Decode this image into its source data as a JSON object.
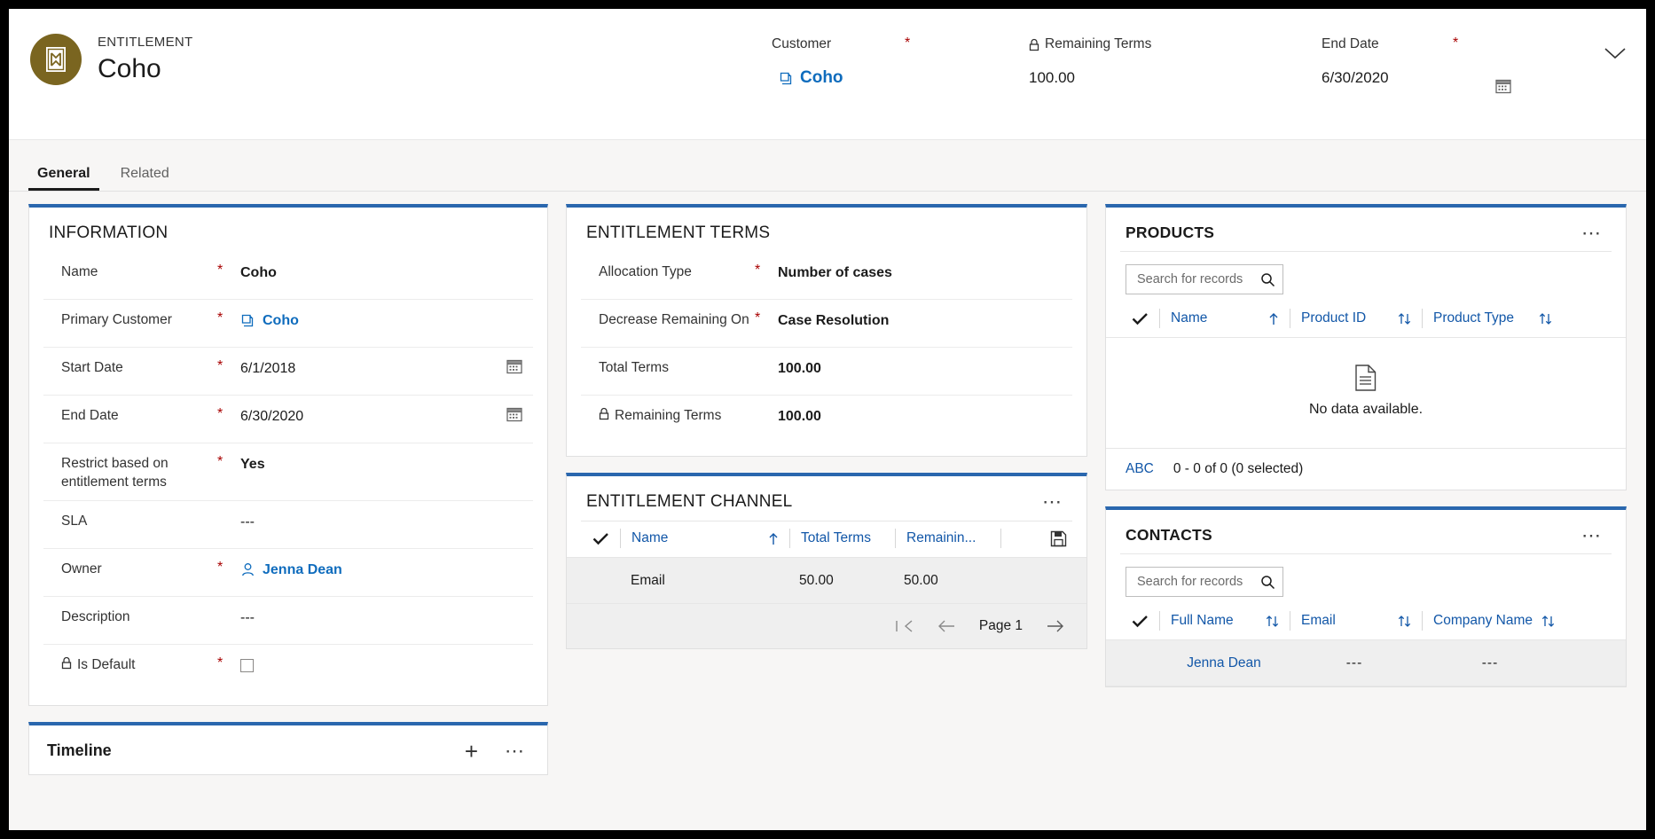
{
  "header": {
    "entity_type": "ENTITLEMENT",
    "record_title": "Coho",
    "avatar_icon": "entitlement-icon",
    "collapse_icon": "chevron-down-icon",
    "fields": [
      {
        "label": "Customer",
        "required": "*",
        "value": "Coho",
        "icon": "lookup-record-icon",
        "is_link": true
      },
      {
        "label": "Remaining Terms",
        "required": "",
        "value": "100.00",
        "icon": "lock-icon",
        "is_link": false
      },
      {
        "label": "End Date",
        "required": "*",
        "value": "6/30/2020",
        "icon": "calendar-icon",
        "is_link": false
      }
    ]
  },
  "tabs": [
    {
      "label": "General",
      "active": true
    },
    {
      "label": "Related",
      "active": false
    }
  ],
  "information": {
    "title": "INFORMATION",
    "rows": [
      {
        "label": "Name",
        "required": "*",
        "value": "Coho",
        "type": "text"
      },
      {
        "label": "Primary Customer",
        "required": "*",
        "value": "Coho",
        "type": "lookup"
      },
      {
        "label": "Start Date",
        "required": "*",
        "value": "6/1/2018",
        "type": "date"
      },
      {
        "label": "End Date",
        "required": "*",
        "value": "6/30/2020",
        "type": "date"
      },
      {
        "label": "Restrict based on entitlement terms",
        "required": "*",
        "value": "Yes",
        "type": "text"
      },
      {
        "label": "SLA",
        "required": "",
        "value": "---",
        "type": "empty"
      },
      {
        "label": "Owner",
        "required": "*",
        "value": "Jenna Dean",
        "type": "user"
      },
      {
        "label": "Description",
        "required": "",
        "value": "---",
        "type": "empty"
      },
      {
        "label": "Is Default",
        "required": "*",
        "value": "",
        "type": "checkbox",
        "locked": true
      }
    ]
  },
  "entitlement_terms": {
    "title": "ENTITLEMENT TERMS",
    "rows": [
      {
        "label": "Allocation Type",
        "required": "*",
        "value": "Number of cases",
        "type": "text"
      },
      {
        "label": "Decrease Remaining On",
        "required": "*",
        "value": "Case Resolution",
        "type": "text"
      },
      {
        "label": "Total Terms",
        "required": "",
        "value": "100.00",
        "type": "text"
      },
      {
        "label": "Remaining Terms",
        "required": "",
        "value": "100.00",
        "type": "text",
        "locked": true
      }
    ]
  },
  "entitlement_channel": {
    "title": "ENTITLEMENT CHANNEL",
    "menu_icon": "ellipsis-icon",
    "save_icon": "save-icon",
    "columns": [
      {
        "label": "Name",
        "sort": "ascending-arrow-icon"
      },
      {
        "label": "Total Terms",
        "sort": ""
      },
      {
        "label": "Remainin...",
        "sort": ""
      }
    ],
    "rows": [
      {
        "name": "Email",
        "total_terms": "50.00",
        "remaining_terms": "50.00"
      }
    ],
    "pager": {
      "first_label": "first-page-icon",
      "prev_label": "previous-page-icon",
      "page_label": "Page 1",
      "next_label": "next-page-icon"
    }
  },
  "products": {
    "title": "PRODUCTS",
    "menu_icon": "ellipsis-icon",
    "search_placeholder": "Search for records",
    "search_value": "",
    "columns": [
      {
        "label": "Name",
        "sort": "ascending-arrow-icon"
      },
      {
        "label": "Product ID",
        "sort": "sort-both-icon"
      },
      {
        "label": "Product Type",
        "sort": "sort-both-icon"
      }
    ],
    "empty_message": "No data available.",
    "empty_icon": "no-data-document-icon",
    "footer": {
      "abc_label": "ABC",
      "count_label": "0 - 0 of 0 (0 selected)"
    }
  },
  "contacts": {
    "title": "CONTACTS",
    "menu_icon": "ellipsis-icon",
    "search_placeholder": "Search for records",
    "search_value": "",
    "columns": [
      {
        "label": "Full Name",
        "sort": "sort-both-icon"
      },
      {
        "label": "Email",
        "sort": "sort-both-icon"
      },
      {
        "label": "Company Name",
        "sort": "sort-both-icon"
      }
    ],
    "rows": [
      {
        "full_name": "Jenna Dean",
        "email": "---",
        "company_name": "---"
      }
    ]
  },
  "timeline": {
    "title": "Timeline",
    "add_icon": "plus-icon",
    "menu_icon": "ellipsis-icon"
  },
  "colors": {
    "accent": "#2a67ae",
    "link": "#0f6cbd",
    "required": "#a80000",
    "avatar": "#7a6520"
  }
}
